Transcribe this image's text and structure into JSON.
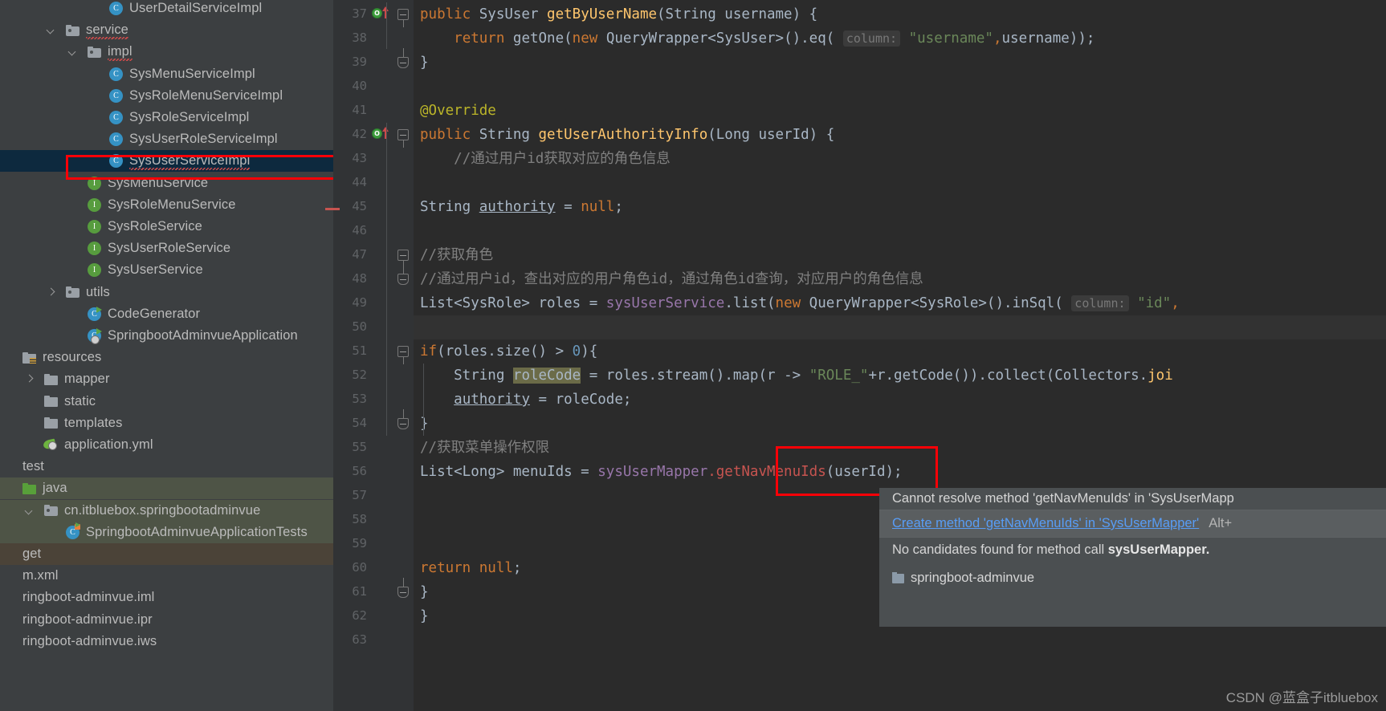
{
  "colors": {
    "editor_bg": "#2b2b2b",
    "tree_bg": "#3c3f41",
    "gutter_bg": "#313335",
    "selection_blue": "#0d293e",
    "selection_green": "#4e5446",
    "annotation_red": "#fb0007",
    "link_blue": "#589df6",
    "keyword_orange": "#cc7832",
    "method_yellow": "#ffc66d",
    "string_green": "#6a8759",
    "field_purple": "#9876aa",
    "comment_grey": "#808080",
    "error_red": "#c75450"
  },
  "tree": {
    "name": "project-tree",
    "items": [
      {
        "label": "UserDetailServiceImpl",
        "indent": 4,
        "icon": "class-icon",
        "arrow": "none",
        "selected": "none"
      },
      {
        "label": "service",
        "indent": 2,
        "icon": "package-icon",
        "arrow": "down",
        "selected": "none",
        "squiggle": true
      },
      {
        "label": "impl",
        "indent": 3,
        "icon": "package-icon",
        "arrow": "down",
        "selected": "none",
        "squiggle": true
      },
      {
        "label": "SysMenuServiceImpl",
        "indent": 4,
        "icon": "class-icon",
        "arrow": "none",
        "selected": "none"
      },
      {
        "label": "SysRoleMenuServiceImpl",
        "indent": 4,
        "icon": "class-icon",
        "arrow": "none",
        "selected": "none"
      },
      {
        "label": "SysRoleServiceImpl",
        "indent": 4,
        "icon": "class-icon",
        "arrow": "none",
        "selected": "none"
      },
      {
        "label": "SysUserRoleServiceImpl",
        "indent": 4,
        "icon": "class-icon",
        "arrow": "none",
        "selected": "none"
      },
      {
        "label": "SysUserServiceImpl",
        "indent": 4,
        "icon": "class-icon",
        "arrow": "none",
        "selected": "blue",
        "squiggle": true
      },
      {
        "label": "SysMenuService",
        "indent": 3,
        "icon": "interface-icon",
        "arrow": "none",
        "selected": "none"
      },
      {
        "label": "SysRoleMenuService",
        "indent": 3,
        "icon": "interface-icon",
        "arrow": "none",
        "selected": "none"
      },
      {
        "label": "SysRoleService",
        "indent": 3,
        "icon": "interface-icon",
        "arrow": "none",
        "selected": "none"
      },
      {
        "label": "SysUserRoleService",
        "indent": 3,
        "icon": "interface-icon",
        "arrow": "none",
        "selected": "none"
      },
      {
        "label": "SysUserService",
        "indent": 3,
        "icon": "interface-icon",
        "arrow": "none",
        "selected": "none"
      },
      {
        "label": "utils",
        "indent": 2,
        "icon": "package-icon",
        "arrow": "right",
        "selected": "none"
      },
      {
        "label": "CodeGenerator",
        "indent": 3,
        "icon": "runnable-class-icon",
        "arrow": "none",
        "selected": "none"
      },
      {
        "label": "SpringbootAdminvueApplication",
        "indent": 3,
        "icon": "spring-boot-icon",
        "arrow": "none",
        "selected": "none"
      },
      {
        "label": "resources",
        "indent": 0,
        "icon": "resources-folder-icon",
        "arrow": "none",
        "selected": "none"
      },
      {
        "label": "mapper",
        "indent": 1,
        "icon": "folder-icon",
        "arrow": "right",
        "selected": "none"
      },
      {
        "label": "static",
        "indent": 1,
        "icon": "folder-icon",
        "arrow": "none",
        "selected": "none"
      },
      {
        "label": "templates",
        "indent": 1,
        "icon": "folder-icon",
        "arrow": "none",
        "selected": "none"
      },
      {
        "label": "application.yml",
        "indent": 1,
        "icon": "yaml-spring-icon",
        "arrow": "none",
        "selected": "none"
      },
      {
        "label": "test",
        "indent": 0,
        "icon": "none",
        "arrow": "none",
        "selected": "none"
      },
      {
        "label": "java",
        "indent": 0,
        "icon": "java-source-folder-icon",
        "arrow": "none",
        "selected": "green"
      },
      {
        "label": "cn.itbluebox.springbootadminvue",
        "indent": 1,
        "icon": "package-icon",
        "arrow": "down",
        "selected": "green"
      },
      {
        "label": "SpringbootAdminvueApplicationTests",
        "indent": 2,
        "icon": "test-class-icon",
        "arrow": "none",
        "selected": "green"
      },
      {
        "label": "get",
        "indent": 0,
        "icon": "none",
        "arrow": "none",
        "selected": "brown"
      },
      {
        "label": "m.xml",
        "indent": 0,
        "icon": "none",
        "arrow": "none",
        "selected": "none"
      },
      {
        "label": "ringboot-adminvue.iml",
        "indent": 0,
        "icon": "none",
        "arrow": "none",
        "selected": "none"
      },
      {
        "label": "ringboot-adminvue.ipr",
        "indent": 0,
        "icon": "none",
        "arrow": "none",
        "selected": "none"
      },
      {
        "label": "ringboot-adminvue.iws",
        "indent": 0,
        "icon": "none",
        "arrow": "none",
        "selected": "none"
      }
    ]
  },
  "editor": {
    "name": "code-editor",
    "line_numbers": [
      "37",
      "38",
      "39",
      "40",
      "41",
      "42",
      "43",
      "44",
      "45",
      "46",
      "47",
      "48",
      "49",
      "50",
      "51",
      "52",
      "53",
      "54",
      "55",
      "56",
      "57",
      "58",
      "59",
      "60",
      "61",
      "62",
      "63"
    ],
    "lines": [
      {
        "num": "37",
        "gutter": "override-marker",
        "fold": "open",
        "html": "<span class=\"kw\">public</span> SysUser <span class=\"mth\">getByUserName</span>(String username) {"
      },
      {
        "num": "38",
        "gutter": "",
        "fold": "",
        "html": "    <span class=\"kw\">return</span> getOne(<span class=\"kw\">new</span> QueryWrapper&lt;SysUser&gt;().eq( <span class=\"hint\">column:</span> <span class=\"str\">\"username\"</span><span class=\"kw\">,</span>username));"
      },
      {
        "num": "39",
        "gutter": "",
        "fold": "end",
        "html": "}"
      },
      {
        "num": "40",
        "gutter": "",
        "fold": "",
        "html": ""
      },
      {
        "num": "41",
        "gutter": "",
        "fold": "",
        "html": "<span class=\"anno\">@Override</span>"
      },
      {
        "num": "42",
        "gutter": "override-marker",
        "fold": "open",
        "html": "<span class=\"kw\">public</span> String <span class=\"mth\">getUserAuthorityInfo</span>(Long userId) {"
      },
      {
        "num": "43",
        "gutter": "",
        "fold": "",
        "html": "    <span class=\"cmt\">//通过用户id获取对应的角色信息</span>"
      },
      {
        "num": "44",
        "gutter": "",
        "fold": "",
        "html": ""
      },
      {
        "num": "45",
        "gutter": "",
        "fold": "",
        "html": "String <span class=\"underline-ident\">authority</span> = <span class=\"kw\">null</span>;"
      },
      {
        "num": "46",
        "gutter": "",
        "fold": "",
        "html": ""
      },
      {
        "num": "47",
        "gutter": "",
        "fold": "open",
        "html": "<span class=\"cmt\">//获取角色</span>"
      },
      {
        "num": "48",
        "gutter": "",
        "fold": "end",
        "html": "<span class=\"cmt\">//通过用户id，查出对应的用户角色id，通过角色id查询，对应用户的角色信息</span>"
      },
      {
        "num": "49",
        "gutter": "",
        "fold": "",
        "html": "List&lt;SysRole&gt; roles = <span class=\"fld\">sysUserService</span>.list(<span class=\"kw\">new</span> QueryWrapper&lt;SysRole&gt;().inSql( <span class=\"hint\">column:</span> <span class=\"str\">\"id\"</span><span class=\"kw\">,</span>"
      },
      {
        "num": "50",
        "gutter": "",
        "fold": "",
        "html": ""
      },
      {
        "num": "51",
        "gutter": "",
        "fold": "open",
        "html": "<span class=\"kw\">if</span>(roles.size() &gt; <span class=\"num\">0</span>){"
      },
      {
        "num": "52",
        "gutter": "",
        "fold": "",
        "html": "    String <span class=\"hl-ident\">roleCode</span> = roles.stream().map(r -&gt; <span class=\"str\">\"ROLE_\"</span>+r.getCode()).collect(Collectors.<span class=\"mth\">joi</span>"
      },
      {
        "num": "53",
        "gutter": "",
        "fold": "",
        "html": "    <span class=\"underline-ident\">authority</span> = roleCode;"
      },
      {
        "num": "54",
        "gutter": "",
        "fold": "end",
        "html": "}"
      },
      {
        "num": "55",
        "gutter": "",
        "fold": "",
        "html": "<span class=\"cmt\">//获取菜单操作权限</span>"
      },
      {
        "num": "56",
        "gutter": "",
        "fold": "",
        "html": "List&lt;Long&gt; menuIds = <span class=\"fld\">sysUserMapper</span><span class=\"err\">.getNavMenuIds</span>(userId);"
      },
      {
        "num": "57",
        "gutter": "",
        "fold": "",
        "html": ""
      },
      {
        "num": "58",
        "gutter": "",
        "fold": "",
        "html": ""
      },
      {
        "num": "59",
        "gutter": "",
        "fold": "",
        "html": ""
      },
      {
        "num": "60",
        "gutter": "",
        "fold": "",
        "html": "<span class=\"kw\">return</span> <span class=\"kw\">null</span>;"
      },
      {
        "num": "61",
        "gutter": "",
        "fold": "end",
        "html": "}"
      },
      {
        "num": "62",
        "gutter": "",
        "fold": "",
        "html": "}"
      },
      {
        "num": "63",
        "gutter": "",
        "fold": "",
        "html": ""
      }
    ],
    "plain_text_lines": [
      "public SysUser getByUserName(String username) {",
      "    return getOne(new QueryWrapper<SysUser>().eq( column: \"username\",username));",
      "}",
      "",
      "@Override",
      "public String getUserAuthorityInfo(Long userId) {",
      "    //通过用户id获取对应的角色信息",
      "",
      "    String authority = null;",
      "",
      "    //获取角色",
      "    //通过用户id，查出对应的用户角色id，通过角色id查询，对应用户的角色信息",
      "    List<SysRole> roles = sysUserService.list(new QueryWrapper<SysRole>().inSql( column: \"id\",",
      "",
      "    if(roles.size() > 0){",
      "        String roleCode = roles.stream().map(r -> \"ROLE_\"+r.getCode()).collect(Collectors.joi",
      "        authority = roleCode;",
      "    }",
      "    //获取菜单操作权限",
      "    List<Long> menuIds = sysUserMapper.getNavMenuIds(userId);",
      "",
      "",
      "",
      "    return null;",
      "}",
      "}",
      ""
    ]
  },
  "popup": {
    "name": "inspection-tooltip",
    "error_message": "Cannot resolve method 'getNavMenuIds' in 'SysUserMapp",
    "quickfix_label": "Create method 'getNavMenuIds' in 'SysUserMapper'",
    "quickfix_shortcut": "Alt+",
    "candidates_text_prefix": "No candidates found for method call ",
    "candidates_text_bold": "sysUserMapper.",
    "module_name": "springboot-adminvue"
  },
  "watermark": {
    "text": "CSDN @蓝盒子itbluebox"
  }
}
